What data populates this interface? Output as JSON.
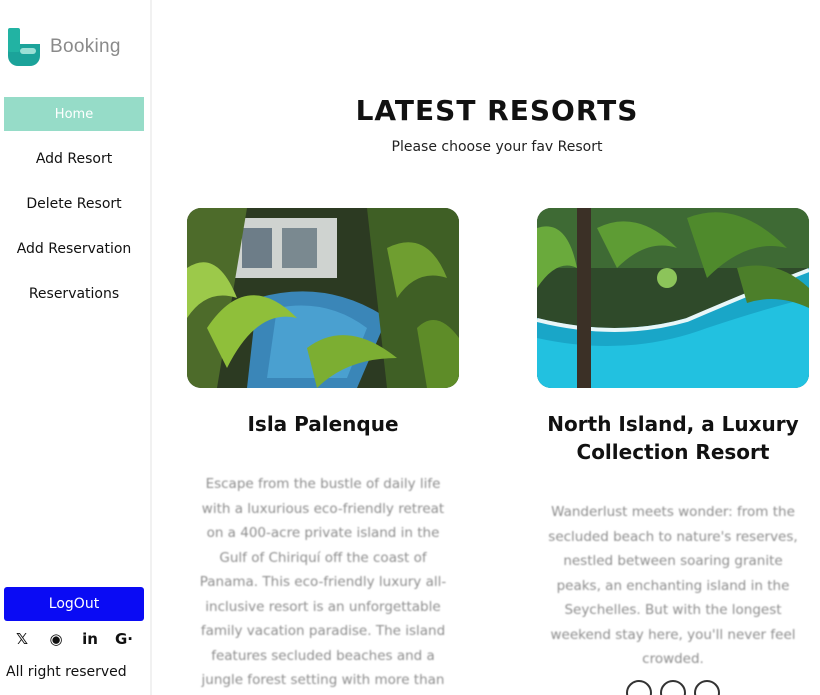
{
  "sidebar": {
    "brand": "Booking",
    "active_item": "Home",
    "items": [
      {
        "label": "Add Resort"
      },
      {
        "label": "Delete Resort"
      },
      {
        "label": "Add Reservation"
      },
      {
        "label": "Reservations"
      }
    ],
    "logout_label": "LogOut",
    "social_icons": [
      "x-icon",
      "github-icon",
      "linkedin-icon",
      "google-icon"
    ],
    "social_glyphs": {
      "x": "𝕏",
      "github": "◉",
      "linkedin": "in",
      "google": "G·"
    },
    "footer_text": "All right reserved",
    "colors": {
      "active_bg": "#96dcc8",
      "logout_bg": "#0a0bf4",
      "brand": "#22b3a3"
    }
  },
  "main": {
    "title": "LATEST RESORTS",
    "subtitle": "Please choose your fav Resort",
    "resorts": [
      {
        "name": "Isla Palenque",
        "description": "Escape from the bustle of daily life with a luxurious eco-friendly retreat on a 400-acre private island in the Gulf of Chiriquí off the coast of Panama. This eco-friendly luxury all-inclusive resort is an unforgettable family vacation paradise. The island features secluded beaches and a jungle forest setting with more than"
      },
      {
        "name": "North Island, a Luxury Collection Resort",
        "description": "Wanderlust meets wonder: from the secluded beach to nature's reserves, nestled between soaring granite peaks, an enchanting island in the Seychelles. But with the longest weekend stay here, you'll never feel crowded."
      }
    ]
  }
}
